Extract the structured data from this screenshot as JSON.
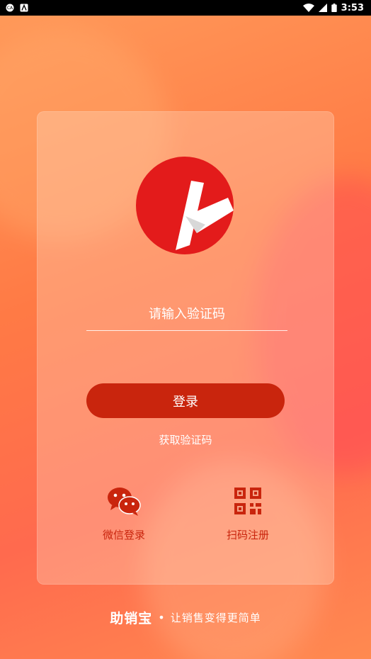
{
  "status_bar": {
    "time": "3:53",
    "icons": [
      "ca-notification-icon",
      "a-notification-icon",
      "wifi-icon",
      "signal-icon",
      "battery-icon"
    ]
  },
  "login": {
    "code_placeholder": "请输入验证码",
    "login_label": "登录",
    "get_code_label": "获取验证码"
  },
  "options": {
    "wechat_label": "微信登录",
    "scan_label": "扫码注册"
  },
  "footer": {
    "brand": "助销宝",
    "separator": "•",
    "slogan": "让销售变得更简单"
  },
  "colors": {
    "accent": "#c9250d",
    "logo_red": "#e31b1b",
    "background": "#ff7a45"
  }
}
